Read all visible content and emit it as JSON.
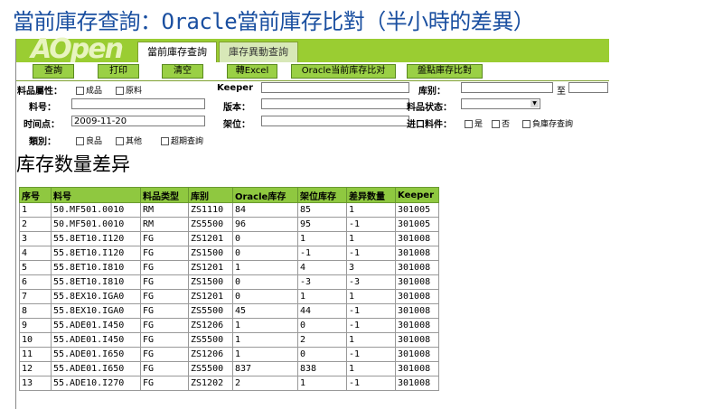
{
  "slide_title": "當前庫存查詢：Oracle當前庫存比對（半小時的差異）",
  "logo": "AOpen",
  "tabs": [
    {
      "label": "當前庫存查詢",
      "active": true
    },
    {
      "label": "庫存異動查詢",
      "active": false
    }
  ],
  "buttons": {
    "query": "查詢",
    "print": "打印",
    "clear": "清空",
    "export": "轉Excel",
    "oracle_compare": "Oracle当前库存比对",
    "inventory_compare": "盤點庫存比對"
  },
  "form": {
    "material_attr_label": "料品屬性：",
    "finished_label": "成品",
    "raw_label": "原料",
    "keeper_label": "Keeper",
    "warehouse_label": "库别：",
    "to_label": "至",
    "item_no_label": "料号：",
    "version_label": "版本：",
    "item_status_label": "料品状态：",
    "time_label": "时间点：",
    "time_value": "2009-11-20",
    "shelf_label": "架位：",
    "import_label": "进口料件：",
    "yes_label": "是",
    "no_label": "否",
    "neg_stock_label": "負庫存查詢",
    "category_label": "類別：",
    "good_label": "良品",
    "other_label": "其他",
    "overdue_label": "超期查詢"
  },
  "section_title": "库存数量差异",
  "table": {
    "headers": [
      "序号",
      "料号",
      "料品类型",
      "库别",
      "Oracle库存",
      "架位库存",
      "差异数量",
      "Keeper"
    ],
    "rows": [
      [
        "1",
        "50.MF501.0010",
        "RM",
        "ZS1110",
        "84",
        "85",
        "1",
        "301005"
      ],
      [
        "2",
        "50.MF501.0010",
        "RM",
        "ZS5500",
        "96",
        "95",
        "-1",
        "301005"
      ],
      [
        "3",
        "55.8ET10.I120",
        "FG",
        "ZS1201",
        "0",
        "1",
        "1",
        "301008"
      ],
      [
        "4",
        "55.8ET10.I120",
        "FG",
        "ZS1500",
        "0",
        "-1",
        "-1",
        "301008"
      ],
      [
        "5",
        "55.8ET10.I810",
        "FG",
        "ZS1201",
        "1",
        "4",
        "3",
        "301008"
      ],
      [
        "6",
        "55.8ET10.I810",
        "FG",
        "ZS1500",
        "0",
        "-3",
        "-3",
        "301008"
      ],
      [
        "7",
        "55.8EX10.IGA0",
        "FG",
        "ZS1201",
        "0",
        "1",
        "1",
        "301008"
      ],
      [
        "8",
        "55.8EX10.IGA0",
        "FG",
        "ZS5500",
        "45",
        "44",
        "-1",
        "301008"
      ],
      [
        "9",
        "55.ADE01.I450",
        "FG",
        "ZS1206",
        "1",
        "0",
        "-1",
        "301008"
      ],
      [
        "10",
        "55.ADE01.I450",
        "FG",
        "ZS5500",
        "1",
        "2",
        "1",
        "301008"
      ],
      [
        "11",
        "55.ADE01.I650",
        "FG",
        "ZS1206",
        "1",
        "0",
        "-1",
        "301008"
      ],
      [
        "12",
        "55.ADE01.I650",
        "FG",
        "ZS5500",
        "837",
        "838",
        "1",
        "301008"
      ],
      [
        "13",
        "55.ADE10.I270",
        "FG",
        "ZS1202",
        "2",
        "1",
        "-1",
        "301008"
      ]
    ]
  }
}
